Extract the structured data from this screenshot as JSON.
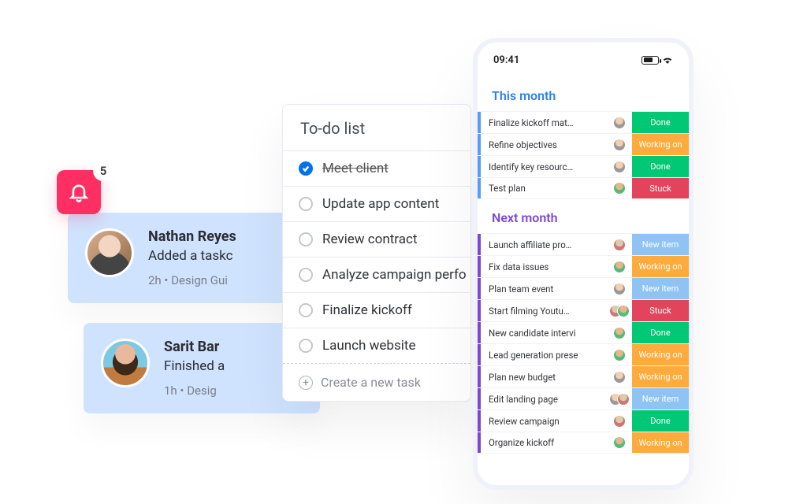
{
  "bell": {
    "count": "5"
  },
  "notifications": [
    {
      "name": "Nathan Reyes",
      "line": "Added a taskc",
      "meta": "2h • Design Gui"
    },
    {
      "name": "Sarit Bar",
      "line": "Finished a",
      "meta": "1h • Desig"
    }
  ],
  "todo": {
    "title": "To-do list",
    "items": [
      {
        "label": "Meet client",
        "done": true
      },
      {
        "label": "Update app content",
        "done": false
      },
      {
        "label": "Review contract",
        "done": false
      },
      {
        "label": "Analyze campaign perfo",
        "done": false
      },
      {
        "label": "Finalize kickoff",
        "done": false
      },
      {
        "label": "Launch website",
        "done": false
      }
    ],
    "create": "Create a new task"
  },
  "phone": {
    "time": "09:41",
    "sections": {
      "this": {
        "label": "This month",
        "rows": [
          {
            "task": "Finalize kickoff mat…",
            "status": "Done",
            "cls": "done",
            "ppl": 1
          },
          {
            "task": "Refine objectives",
            "status": "Working on",
            "cls": "work",
            "ppl": 1
          },
          {
            "task": "Identify key resourc…",
            "status": "Done",
            "cls": "done",
            "ppl": 1
          },
          {
            "task": "Test plan",
            "status": "Stuck",
            "cls": "stuck",
            "ppl": 1
          }
        ]
      },
      "next": {
        "label": "Next month",
        "rows": [
          {
            "task": "Launch affiliate pro…",
            "status": "New item",
            "cls": "new",
            "ppl": 1
          },
          {
            "task": "Fix data issues",
            "status": "Working on",
            "cls": "work",
            "ppl": 1
          },
          {
            "task": "Plan team event",
            "status": "New item",
            "cls": "new",
            "ppl": 1
          },
          {
            "task": "Start filming Youtu…",
            "status": "Stuck",
            "cls": "stuck",
            "ppl": 2
          },
          {
            "task": "New candidate intervi",
            "status": "Done",
            "cls": "done",
            "ppl": 1
          },
          {
            "task": "Lead generation prese",
            "status": "Working on",
            "cls": "work",
            "ppl": 1
          },
          {
            "task": "Plan new budget",
            "status": "Working on",
            "cls": "work",
            "ppl": 1
          },
          {
            "task": "Edit landing page",
            "status": "New item",
            "cls": "new",
            "ppl": 2
          },
          {
            "task": "Review campaign",
            "status": "Done",
            "cls": "done",
            "ppl": 1
          },
          {
            "task": "Organize kickoff",
            "status": "Working on",
            "cls": "work",
            "ppl": 1
          }
        ]
      }
    }
  }
}
